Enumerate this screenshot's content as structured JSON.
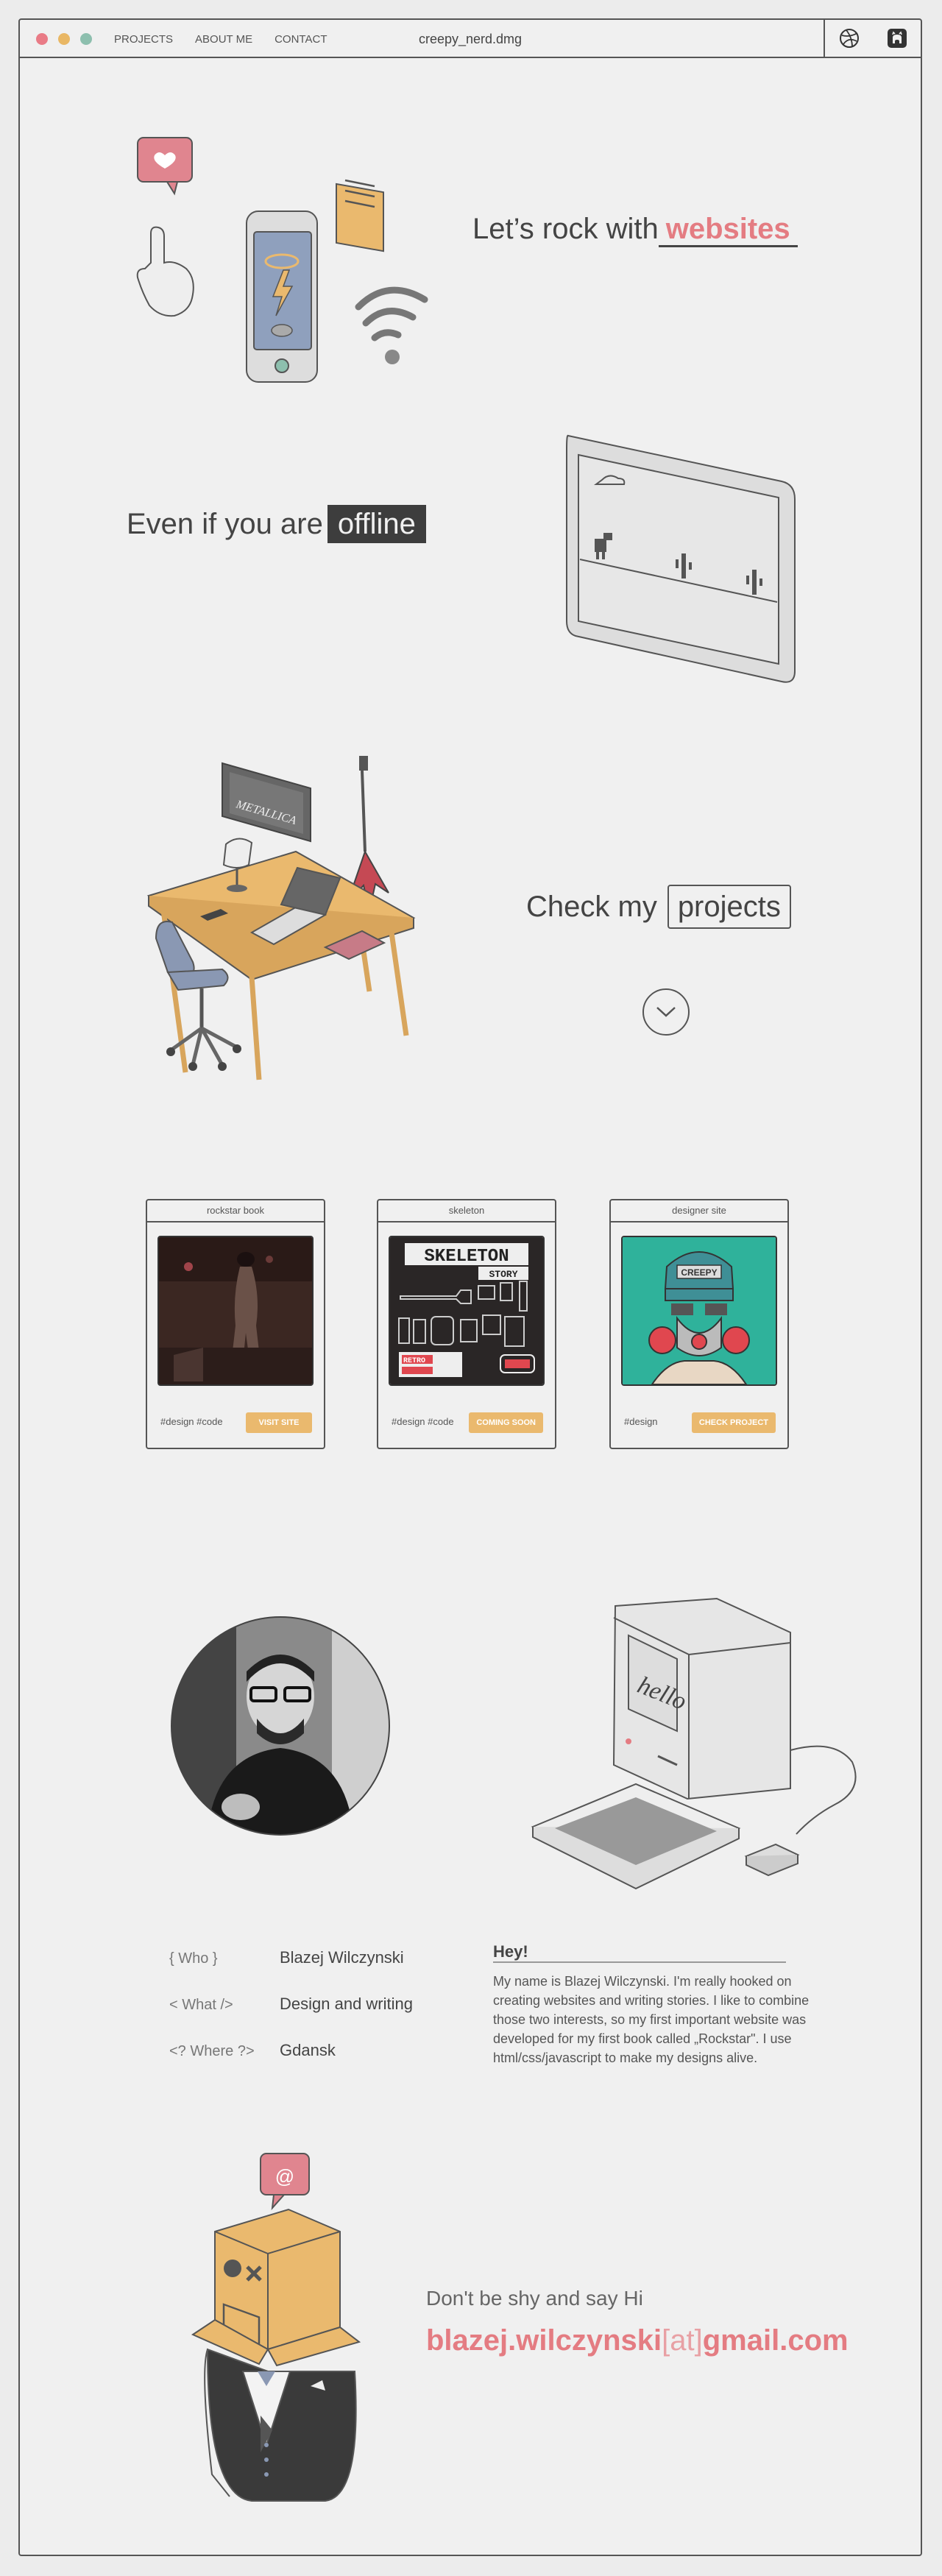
{
  "window": {
    "title": "creepy_nerd.dmg",
    "traffic_lights": [
      "#e97b86",
      "#e9b764",
      "#8dbfae"
    ],
    "nav": [
      "PROJECTS",
      "ABOUT ME",
      "CONTACT"
    ],
    "icons": [
      "dribbble-icon",
      "github-icon"
    ]
  },
  "hero": {
    "line1_prefix": "Let’s rock with",
    "line1_accent": "websites",
    "line2_prefix": "Even if you are",
    "line2_accent": "offline",
    "line3_prefix": "Check my",
    "line3_accent": "projects"
  },
  "illustrations": {
    "monitor_band": "METALLICA",
    "mac_screen": "hello",
    "skeleton_title": "SKELETON",
    "skeleton_sub": "STORY",
    "retro_label": "RETRO",
    "hat_label": "CREEPY"
  },
  "projects": [
    {
      "title": "rockstar book",
      "tags": "#design #code",
      "button": "VISIT SITE"
    },
    {
      "title": "skeleton",
      "tags": "#design #code",
      "button": "COMING SOON"
    },
    {
      "title": "designer site",
      "tags": "#design",
      "button": "CHECK PROJECT"
    }
  ],
  "about": {
    "rows": [
      {
        "key": "{ Who }",
        "value": "Blazej Wilczynski"
      },
      {
        "key": "< What />",
        "value": "Design and writing"
      },
      {
        "key": "<? Where ?>",
        "value": "Gdansk"
      }
    ],
    "hey_title": "Hey!",
    "bio": "My name is Blazej Wilczynski. I'm really hooked on creating websites and writing stories. I like to combine those two interests, so my first important website was developed for my first book called „Rockstar\". I use html/css/javascript to make my designs alive."
  },
  "contact": {
    "subtitle": "Don't be shy and say Hi",
    "email_user": "blazej.wilczynski",
    "email_at": "[at]",
    "email_domain": "gmail.com"
  },
  "colors": {
    "accent": "#e47c82",
    "yellow": "#eab96e",
    "dark": "#3d3d3d",
    "bg": "#f0f0f0"
  }
}
